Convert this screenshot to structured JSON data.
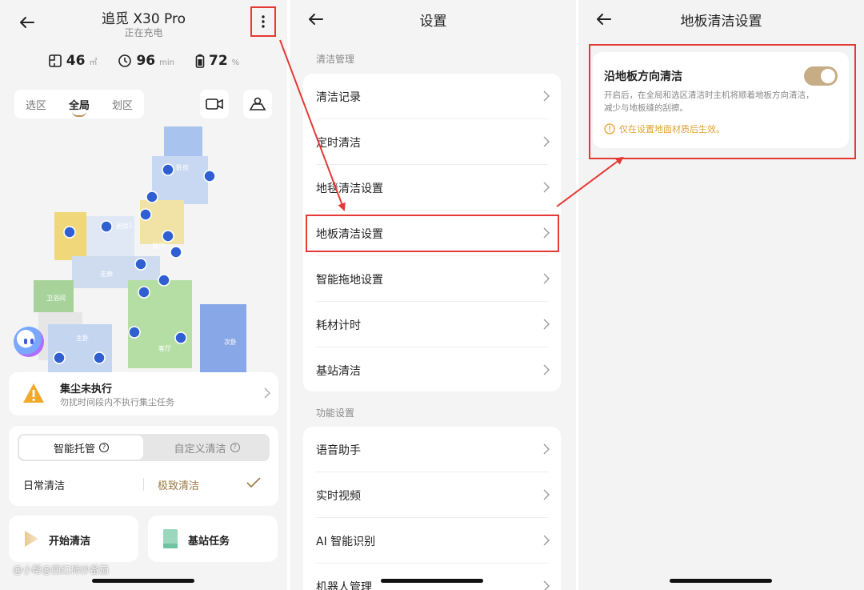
{
  "screen1": {
    "title": "追觅 X30 Pro",
    "status": "正在充电",
    "stats": [
      {
        "icon": "area-icon",
        "value": "46",
        "unit": "㎡"
      },
      {
        "icon": "clock-icon",
        "value": "96",
        "unit": "min"
      },
      {
        "icon": "battery-icon",
        "value": "72",
        "unit": "%"
      }
    ],
    "region_tabs": [
      "选区",
      "全局",
      "划区"
    ],
    "active_region_tab": "全局",
    "map_rooms": [
      "卧房",
      "厨房1",
      "餐厅",
      "走廊",
      "卫浴间",
      "主卧",
      "客厅",
      "次卧"
    ],
    "dust": {
      "title": "集尘未执行",
      "subtitle": "勿扰时间段内不执行集尘任务"
    },
    "modes": {
      "active": "智能托管",
      "inactive": "自定义清洁"
    },
    "daily_label": "日常清洁",
    "level_label": "极致清洁",
    "start_label": "开始清洁",
    "base_label": "基站任务",
    "watermark": "@小帮@西红柿炒番茄"
  },
  "screen2": {
    "title": "设置",
    "section1": "清洁管理",
    "section1_items": [
      "清洁记录",
      "定时清洁",
      "地毯清洁设置",
      "地板清洁设置",
      "智能拖地设置",
      "耗材计时",
      "基站清洁"
    ],
    "section2": "功能设置",
    "section2_items": [
      "语音助手",
      "实时视频",
      "AI 智能识别",
      "机器人管理"
    ],
    "highlighted_item": "地板清洁设置"
  },
  "screen3": {
    "title": "地板清洁设置",
    "setting_title": "沿地板方向清洁",
    "setting_desc": "开启后，在全局和选区清洁时主机将顺着地板方向清洁，减少与地板缝的刮擦。",
    "setting_note": "仅在设置地面材质后生效。",
    "toggle_on": true
  },
  "colors": {
    "annotation": "#e53935",
    "accent": "#b8925a",
    "toggle": "#c6ad86",
    "warning": "#e0a231"
  }
}
